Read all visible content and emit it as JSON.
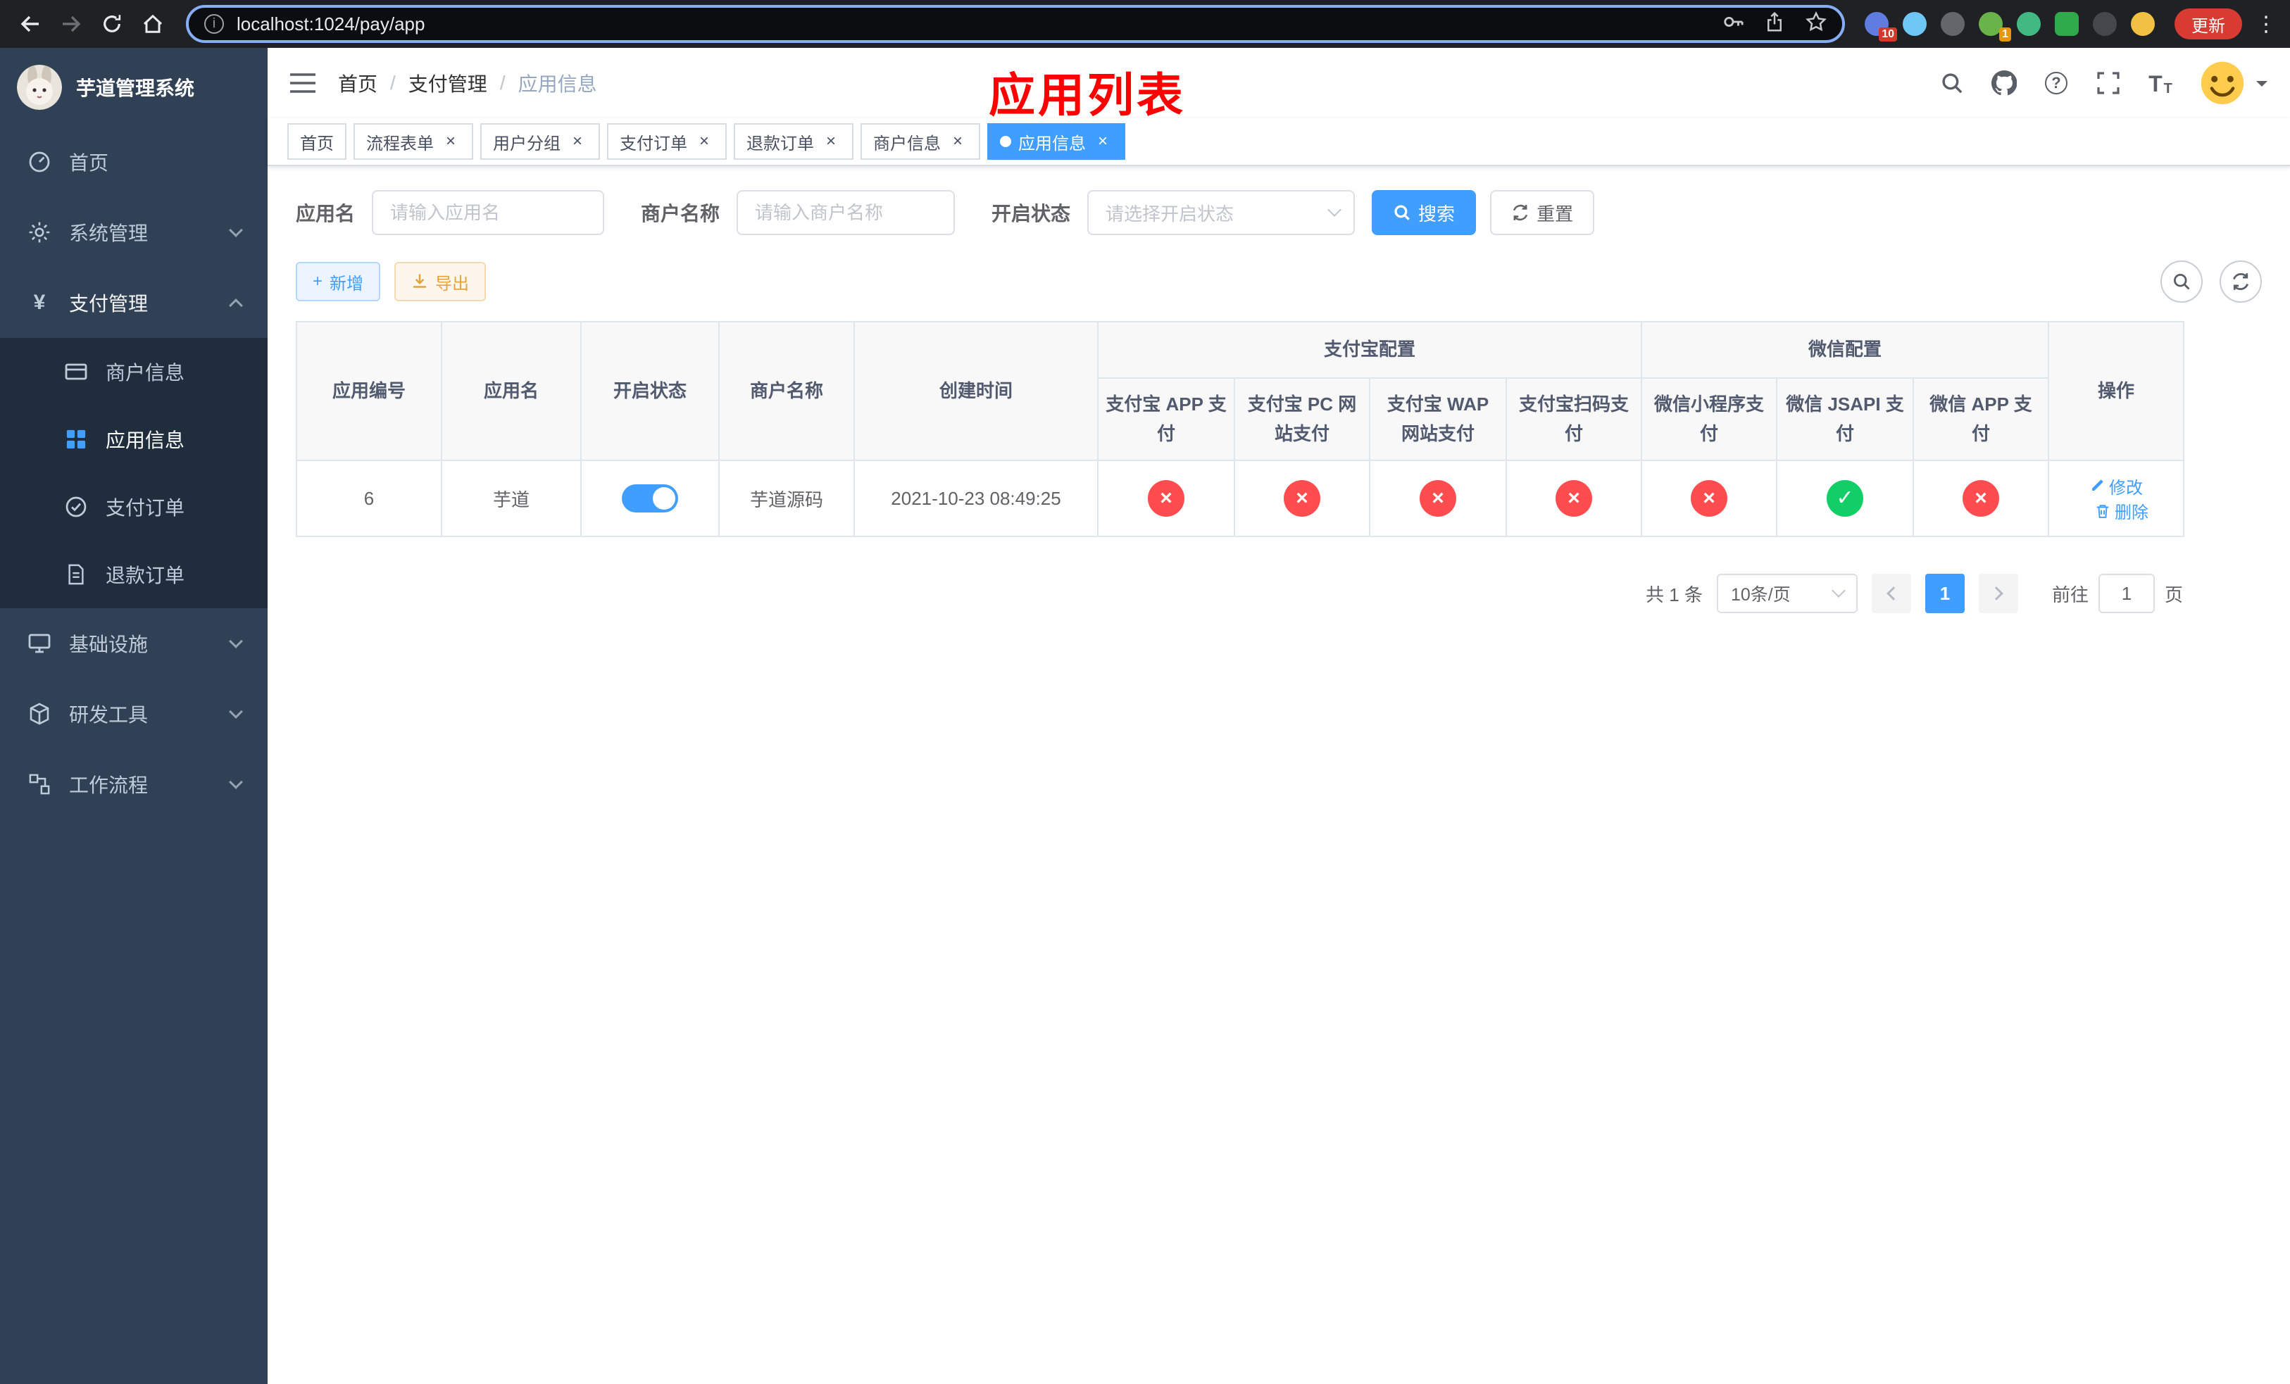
{
  "browser": {
    "url": "localhost:1024/pay/app",
    "update_label": "更新",
    "ext_badge_primary": "10",
    "ext_badge_secondary": "1"
  },
  "sidebar": {
    "title": "芋道管理系统",
    "items": [
      {
        "label": "首页"
      },
      {
        "label": "系统管理"
      },
      {
        "label": "支付管理"
      },
      {
        "label": "基础设施"
      },
      {
        "label": "研发工具"
      },
      {
        "label": "工作流程"
      }
    ],
    "submenu": [
      {
        "label": "商户信息"
      },
      {
        "label": "应用信息"
      },
      {
        "label": "支付订单"
      },
      {
        "label": "退款订单"
      }
    ]
  },
  "header": {
    "breadcrumb": [
      "首页",
      "支付管理",
      "应用信息"
    ],
    "annotation": "应用列表"
  },
  "tabs": [
    {
      "label": "首页"
    },
    {
      "label": "流程表单"
    },
    {
      "label": "用户分组"
    },
    {
      "label": "支付订单"
    },
    {
      "label": "退款订单"
    },
    {
      "label": "商户信息"
    },
    {
      "label": "应用信息"
    }
  ],
  "filters": {
    "app_name_label": "应用名",
    "app_name_placeholder": "请输入应用名",
    "merchant_label": "商户名称",
    "merchant_placeholder": "请输入商户名称",
    "status_label": "开启状态",
    "status_placeholder": "请选择开启状态",
    "search_label": "搜索",
    "reset_label": "重置"
  },
  "toolbar": {
    "add_label": "新增",
    "export_label": "导出"
  },
  "table": {
    "header": {
      "simple": [
        "应用编号",
        "应用名",
        "开启状态",
        "商户名称",
        "创建时间"
      ],
      "alipay_group": "支付宝配置",
      "alipay_cols": [
        "支付宝 APP 支付",
        "支付宝 PC 网站支付",
        "支付宝 WAP 网站支付",
        "支付宝扫码支付"
      ],
      "wechat_group": "微信配置",
      "wechat_cols": [
        "微信小程序支付",
        "微信 JSAPI 支付",
        "微信 APP 支付"
      ],
      "ops": "操作"
    },
    "rows": [
      {
        "id": "6",
        "name": "芋道",
        "enabled": true,
        "merchant": "芋道源码",
        "created": "2021-10-23 08:49:25",
        "configs": [
          false,
          false,
          false,
          false,
          false,
          true,
          false
        ],
        "actions": [
          "修改",
          "删除"
        ]
      }
    ]
  },
  "pagination": {
    "total": "共 1 条",
    "page_size": "10条/页",
    "page": "1",
    "goto_label": "前往",
    "goto_value": "1",
    "page_suffix": "页"
  },
  "colors": {
    "primary": "#409eff",
    "success": "#13ce66",
    "danger": "#ff4d4f",
    "warning": "#e6a23c",
    "sidebar_bg": "#304156",
    "submenu_bg": "#1f2d3d",
    "annotation_red": "#fd0000"
  }
}
